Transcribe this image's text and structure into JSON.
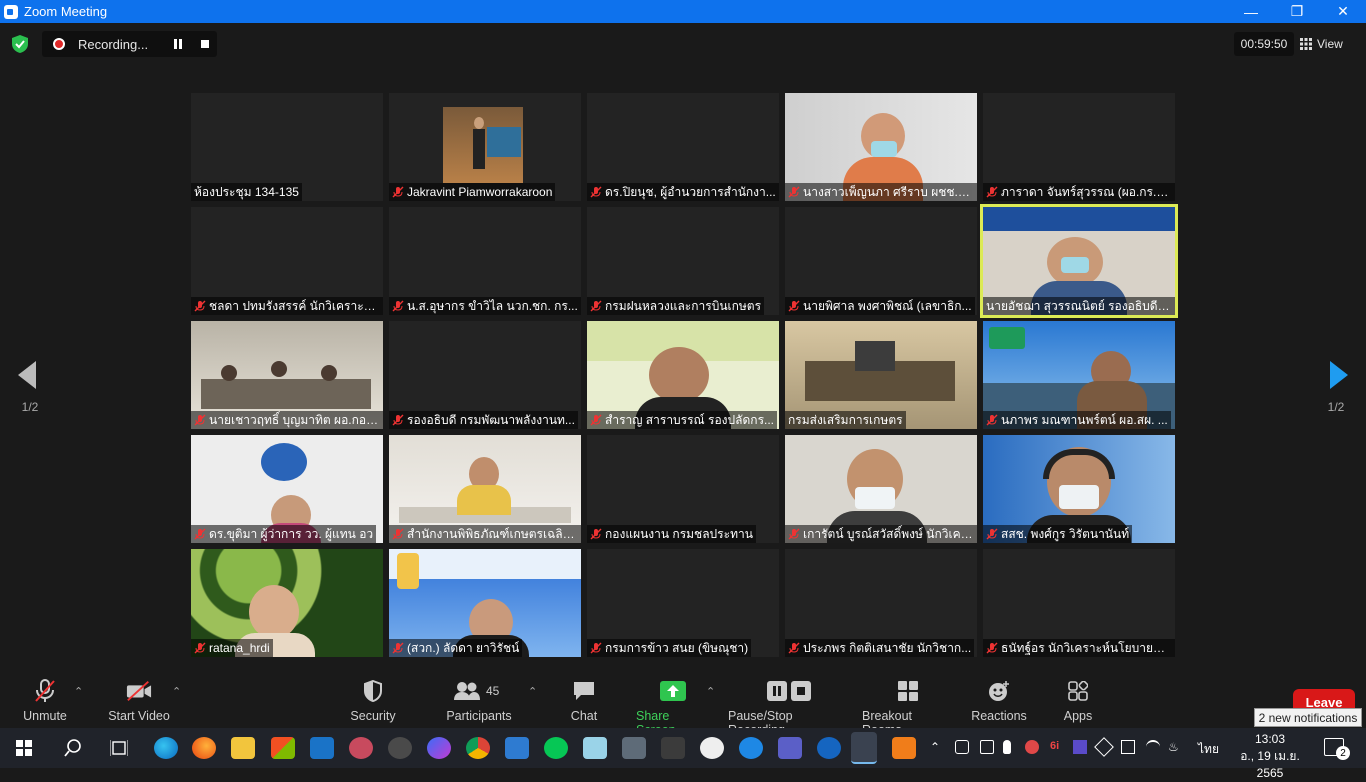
{
  "window": {
    "title": "Zoom Meeting",
    "controls": [
      "minimize-icon",
      "maximize-icon",
      "close-icon"
    ]
  },
  "topbar": {
    "recording_label": "Recording...",
    "timer": "00:59:50",
    "view_label": "View"
  },
  "pagination": {
    "left_label": "1/2",
    "right_label": "1/2"
  },
  "participants": [
    {
      "name": "ห้องประชุม 134-135",
      "muted": false
    },
    {
      "name": "Jakravint Piamworrakaroon",
      "muted": true
    },
    {
      "name": "ดร.ปิยนุช, ผู้อำนวยการสำนักงา...",
      "muted": true
    },
    {
      "name": "นางสาวเพ็ญนภา ศรีราบ ผชช.ด้...",
      "muted": true
    },
    {
      "name": "ภาราดา จันทร์สุวรรณ (ผอ.กร.2...",
      "muted": true
    },
    {
      "name": "ชลดา ปทมรังสรรค์ นักวิเคราะห์น...",
      "muted": true
    },
    {
      "name": "น.ส.อุษากร ขำวิไล นวก.ชก. กร...",
      "muted": true
    },
    {
      "name": "กรมฝนหลวงและการบินเกษตร",
      "muted": true
    },
    {
      "name": "นายพิศาล พงศาพิชณ์ (เลขาธิก...",
      "muted": true
    },
    {
      "name": "นายอัชฌา สุวรรณนิตย์ รองอธิบดีก...",
      "muted": false
    },
    {
      "name": "นายเชาวฤทธิ์ บุญมาทิต ผอ.กอง...",
      "muted": true
    },
    {
      "name": "รองอธิบดี กรมพัฒนาพลังงานท...",
      "muted": true
    },
    {
      "name": "สำราญ สาราบรรณ์ รองปลัดกร...",
      "muted": true
    },
    {
      "name": "กรมส่งเสริมการเกษตร",
      "muted": false
    },
    {
      "name": "นภาพร มณฑานพร์ตน์ ผอ.สผ. ...",
      "muted": true
    },
    {
      "name": "ดร.ขุติมา ผู้ว่าการ วว. ผู้แทน อว",
      "muted": true
    },
    {
      "name": "สำนักงานพิพิธภัณฑ์เกษตรเฉลิม...",
      "muted": true
    },
    {
      "name": "กองแผนงาน กรมชลประทาน",
      "muted": true
    },
    {
      "name": "เการัตน์ บูรณ์สวัสดิ์พงษ์ นักวิเคร...",
      "muted": true
    },
    {
      "name": "สสช. พงศ์กูร วิรัตนานันท์",
      "muted": true
    },
    {
      "name": "ratana_hrdi",
      "muted": true
    },
    {
      "name": "(สวก.) ลัดดา ยาวิรัชน์",
      "muted": true
    },
    {
      "name": "กรมการข้าว สนย (ขิษณุชา)",
      "muted": true
    },
    {
      "name": "ประภพร กิตติเสนาชัย นักวิชาก...",
      "muted": true
    },
    {
      "name": "ธนัทฐ์อร นักวิเคราะห์นโยบายและ...",
      "muted": true
    }
  ],
  "toolbar": {
    "unmute": "Unmute",
    "start_video": "Start Video",
    "security": "Security",
    "participants": "Participants",
    "participants_count": "45",
    "chat": "Chat",
    "share_screen": "Share Screen",
    "pause_recording": "Pause/Stop Recording",
    "breakout_rooms": "Breakout Rooms",
    "reactions": "Reactions",
    "apps": "Apps",
    "leave": "Leave"
  },
  "notification": "2 new notifications",
  "taskbar": {
    "language": "ไทย",
    "time": "13:03",
    "date": "อ., 19 เม.ย. 2565",
    "notification_count": "2"
  },
  "colors": {
    "titlebar": "#0e72ed",
    "active_speaker": "#dcea55",
    "share_green": "#3ed15a",
    "leave_red": "#d91818"
  }
}
